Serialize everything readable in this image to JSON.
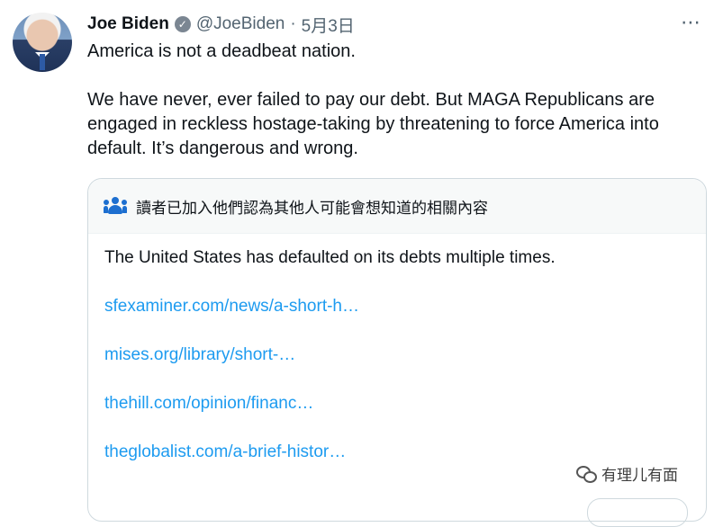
{
  "tweet": {
    "author_name": "Joe Biden",
    "handle": "@JoeBiden",
    "separator": "·",
    "date": "5月3日",
    "more_icon": "more-horizontal-icon",
    "verified_icon": "verified-badge-icon",
    "paragraphs": [
      "America is not a deadbeat nation.",
      "We have never, ever failed to pay our debt. But MAGA Republicans are engaged in reckless hostage-taking by threatening to force America into default. It’s dangerous and wrong."
    ]
  },
  "community_note": {
    "icon": "people-icon",
    "title": "讀者已加入他們認為其他人可能會想知道的相關內容",
    "claim": "The United States has defaulted on its debts multiple times.",
    "links": [
      "sfexaminer.com/news/a-short-h…",
      "mises.org/library/short-…",
      "thehill.com/opinion/financ…",
      "theglobalist.com/a-brief-histor…"
    ]
  },
  "watermark": {
    "icon": "wechat-icon",
    "text": "有理儿有面"
  },
  "colors": {
    "link": "#1d9bf0",
    "muted": "#536471",
    "note_header_bg": "#f7f9f9",
    "border": "#cfd9de"
  }
}
